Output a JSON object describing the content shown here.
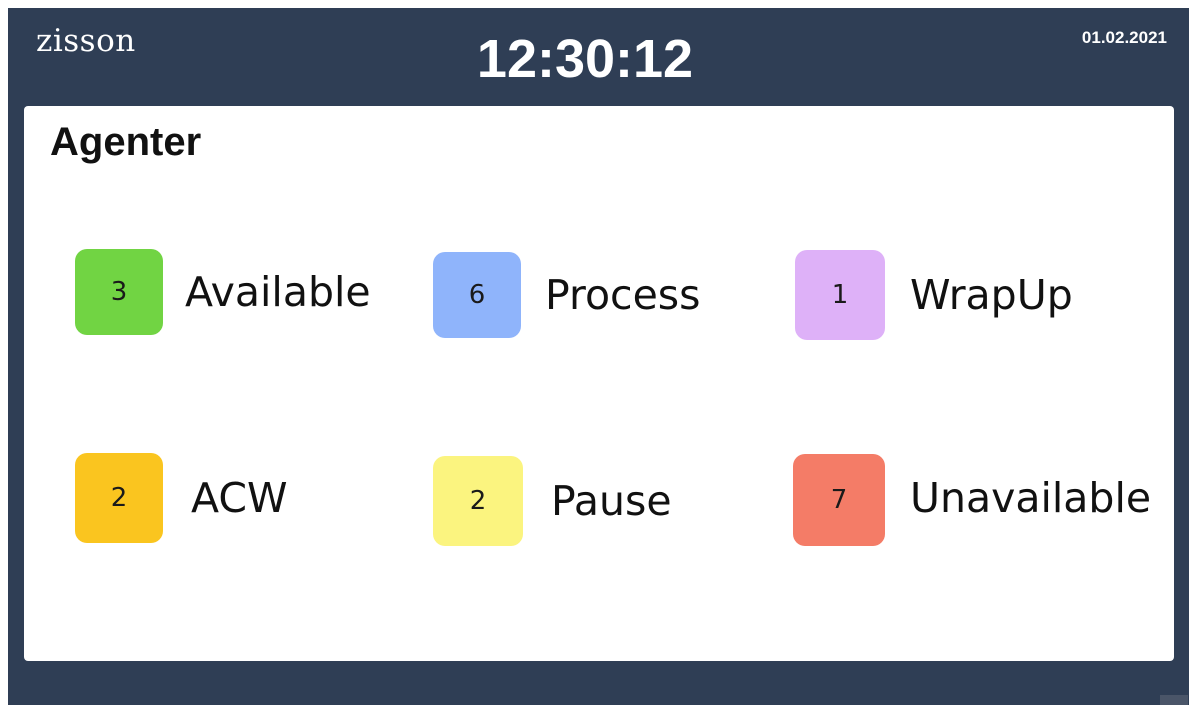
{
  "header": {
    "logo": "zisson",
    "clock": "12:30:12",
    "date": "01.02.2021"
  },
  "panel": {
    "title": "Agenter",
    "stats": [
      {
        "count": "3",
        "label": "Available",
        "color": "#71d443"
      },
      {
        "count": "6",
        "label": "Process",
        "color": "#8fb4fb"
      },
      {
        "count": "1",
        "label": "WrapUp",
        "color": "#deb1f8"
      },
      {
        "count": "2",
        "label": "ACW",
        "color": "#fac51f"
      },
      {
        "count": "2",
        "label": "Pause",
        "color": "#fbf47f"
      },
      {
        "count": "7",
        "label": "Unavailable",
        "color": "#f47c67"
      }
    ]
  }
}
